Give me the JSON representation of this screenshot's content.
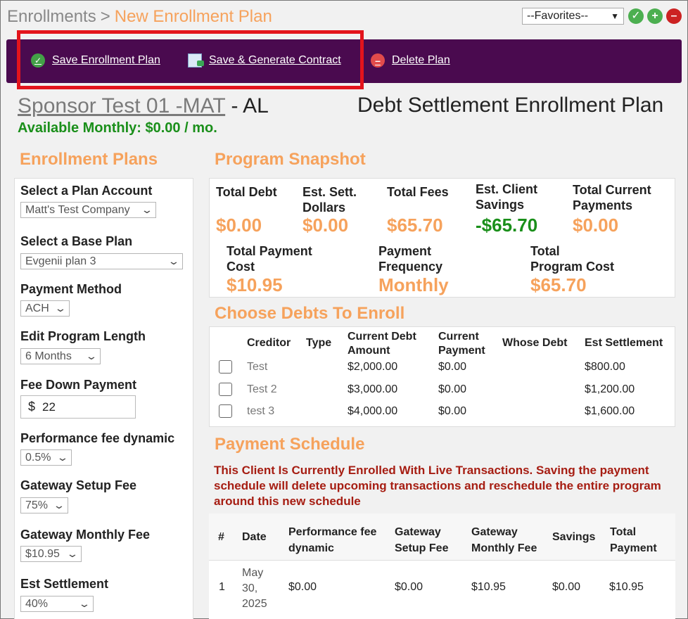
{
  "breadcrumb": {
    "parent": "Enrollments",
    "separator": ">",
    "current": "New Enrollment Plan"
  },
  "favorites": {
    "selected": "--Favorites--"
  },
  "toolbar_icons": [
    "check-icon",
    "plus-icon",
    "minus-icon"
  ],
  "actions": {
    "save": "Save Enrollment Plan",
    "save_generate": "Save & Generate Contract",
    "delete": "Delete Plan"
  },
  "sponsor": {
    "name": "Sponsor Test 01 -MAT",
    "state": "- AL"
  },
  "available_monthly": "Available Monthly: $0.00 / mo.",
  "plan_title": "Debt Settlement Enrollment Plan",
  "left": {
    "heading": "Enrollment Plans",
    "fields": {
      "plan_account": {
        "label": "Select a Plan Account",
        "value": "Matt's Test Company"
      },
      "base_plan": {
        "label": "Select a Base Plan",
        "value": "Evgenii plan 3"
      },
      "payment_method": {
        "label": "Payment Method",
        "value": "ACH"
      },
      "program_length": {
        "label": "Edit Program Length",
        "value": "6 Months"
      },
      "fee_down": {
        "label": "Fee Down Payment",
        "prefix": "$",
        "value": "22"
      },
      "perf_fee": {
        "label": "Performance fee dynamic",
        "value": "0.5%"
      },
      "gateway_setup": {
        "label": "Gateway Setup Fee",
        "value": "75%"
      },
      "gateway_monthly": {
        "label": "Gateway Monthly Fee",
        "value": "$10.95"
      },
      "est_settlement": {
        "label": "Est Settlement",
        "value": "40%"
      }
    }
  },
  "snapshot": {
    "heading": "Program Snapshot",
    "total_debt": {
      "label": "Total Debt",
      "value": "$0.00"
    },
    "est_sett": {
      "label1": "Est. Sett.",
      "label2": "Dollars",
      "value": "$0.00"
    },
    "total_fees": {
      "label": "Total Fees",
      "value": "$65.70"
    },
    "client_savings": {
      "label1": "Est. Client",
      "label2": "Savings",
      "value": "-$65.70"
    },
    "current_payments": {
      "label1": "Total Current",
      "label2": "Payments",
      "value": "$0.00"
    },
    "payment_cost": {
      "label1": "Total Payment",
      "label2": "Cost",
      "value": "$10.95"
    },
    "frequency": {
      "label1": "Payment",
      "label2": "Frequency",
      "value": "Monthly"
    },
    "program_cost": {
      "label1": "Total",
      "label2": "Program Cost",
      "value": "$65.70"
    }
  },
  "debts": {
    "heading": "Choose Debts To Enroll",
    "columns": {
      "creditor": "Creditor",
      "type": "Type",
      "current_debt1": "Current Debt",
      "current_debt2": "Amount",
      "current_payment1": "Current",
      "current_payment2": "Payment",
      "whose": "Whose Debt",
      "est_settlement": "Est Settlement"
    },
    "rows": [
      {
        "creditor": "Test",
        "amount": "$2,000.00",
        "payment": "$0.00",
        "settlement": "$800.00"
      },
      {
        "creditor": "Test 2",
        "amount": "$3,000.00",
        "payment": "$0.00",
        "settlement": "$1,200.00"
      },
      {
        "creditor": "test 3",
        "amount": "$4,000.00",
        "payment": "$0.00",
        "settlement": "$1,600.00"
      }
    ]
  },
  "schedule": {
    "heading": "Payment Schedule",
    "warning": "This Client Is Currently Enrolled With Live Transactions. Saving the payment schedule will delete upcoming transactions and reschedule the entire program around this new schedule",
    "columns": {
      "num": "#",
      "date": "Date",
      "perf1": "Performance fee",
      "perf2": "dynamic",
      "gsetup1": "Gateway",
      "gsetup2": "Setup Fee",
      "gmonthly1": "Gateway",
      "gmonthly2": "Monthly Fee",
      "savings": "Savings",
      "total1": "Total",
      "total2": "Payment"
    },
    "rows": [
      {
        "num": "1",
        "date1": "May",
        "date2": "30,",
        "date3": "2025",
        "perf": "$0.00",
        "setup": "$0.00",
        "monthly": "$10.95",
        "savings": "$0.00",
        "total": "$10.95"
      }
    ]
  }
}
